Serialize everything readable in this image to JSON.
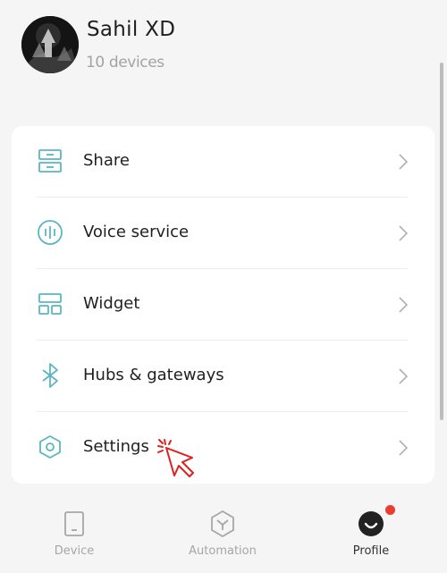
{
  "profile": {
    "name": "Sahil XD",
    "devices": "10 devices"
  },
  "menu": {
    "items": [
      {
        "label": "Share",
        "icon": "share-icon"
      },
      {
        "label": "Voice service",
        "icon": "voice-icon"
      },
      {
        "label": "Widget",
        "icon": "widget-icon"
      },
      {
        "label": "Hubs & gateways",
        "icon": "bluetooth-icon"
      },
      {
        "label": "Settings",
        "icon": "settings-icon"
      }
    ],
    "icon_color": "#5bb6c2"
  },
  "tabbar": {
    "tabs": [
      {
        "label": "Device",
        "icon": "device-icon"
      },
      {
        "label": "Automation",
        "icon": "automation-icon"
      },
      {
        "label": "Profile",
        "icon": "profile-icon",
        "active": true
      }
    ],
    "badge_color": "#ee3b2f"
  }
}
